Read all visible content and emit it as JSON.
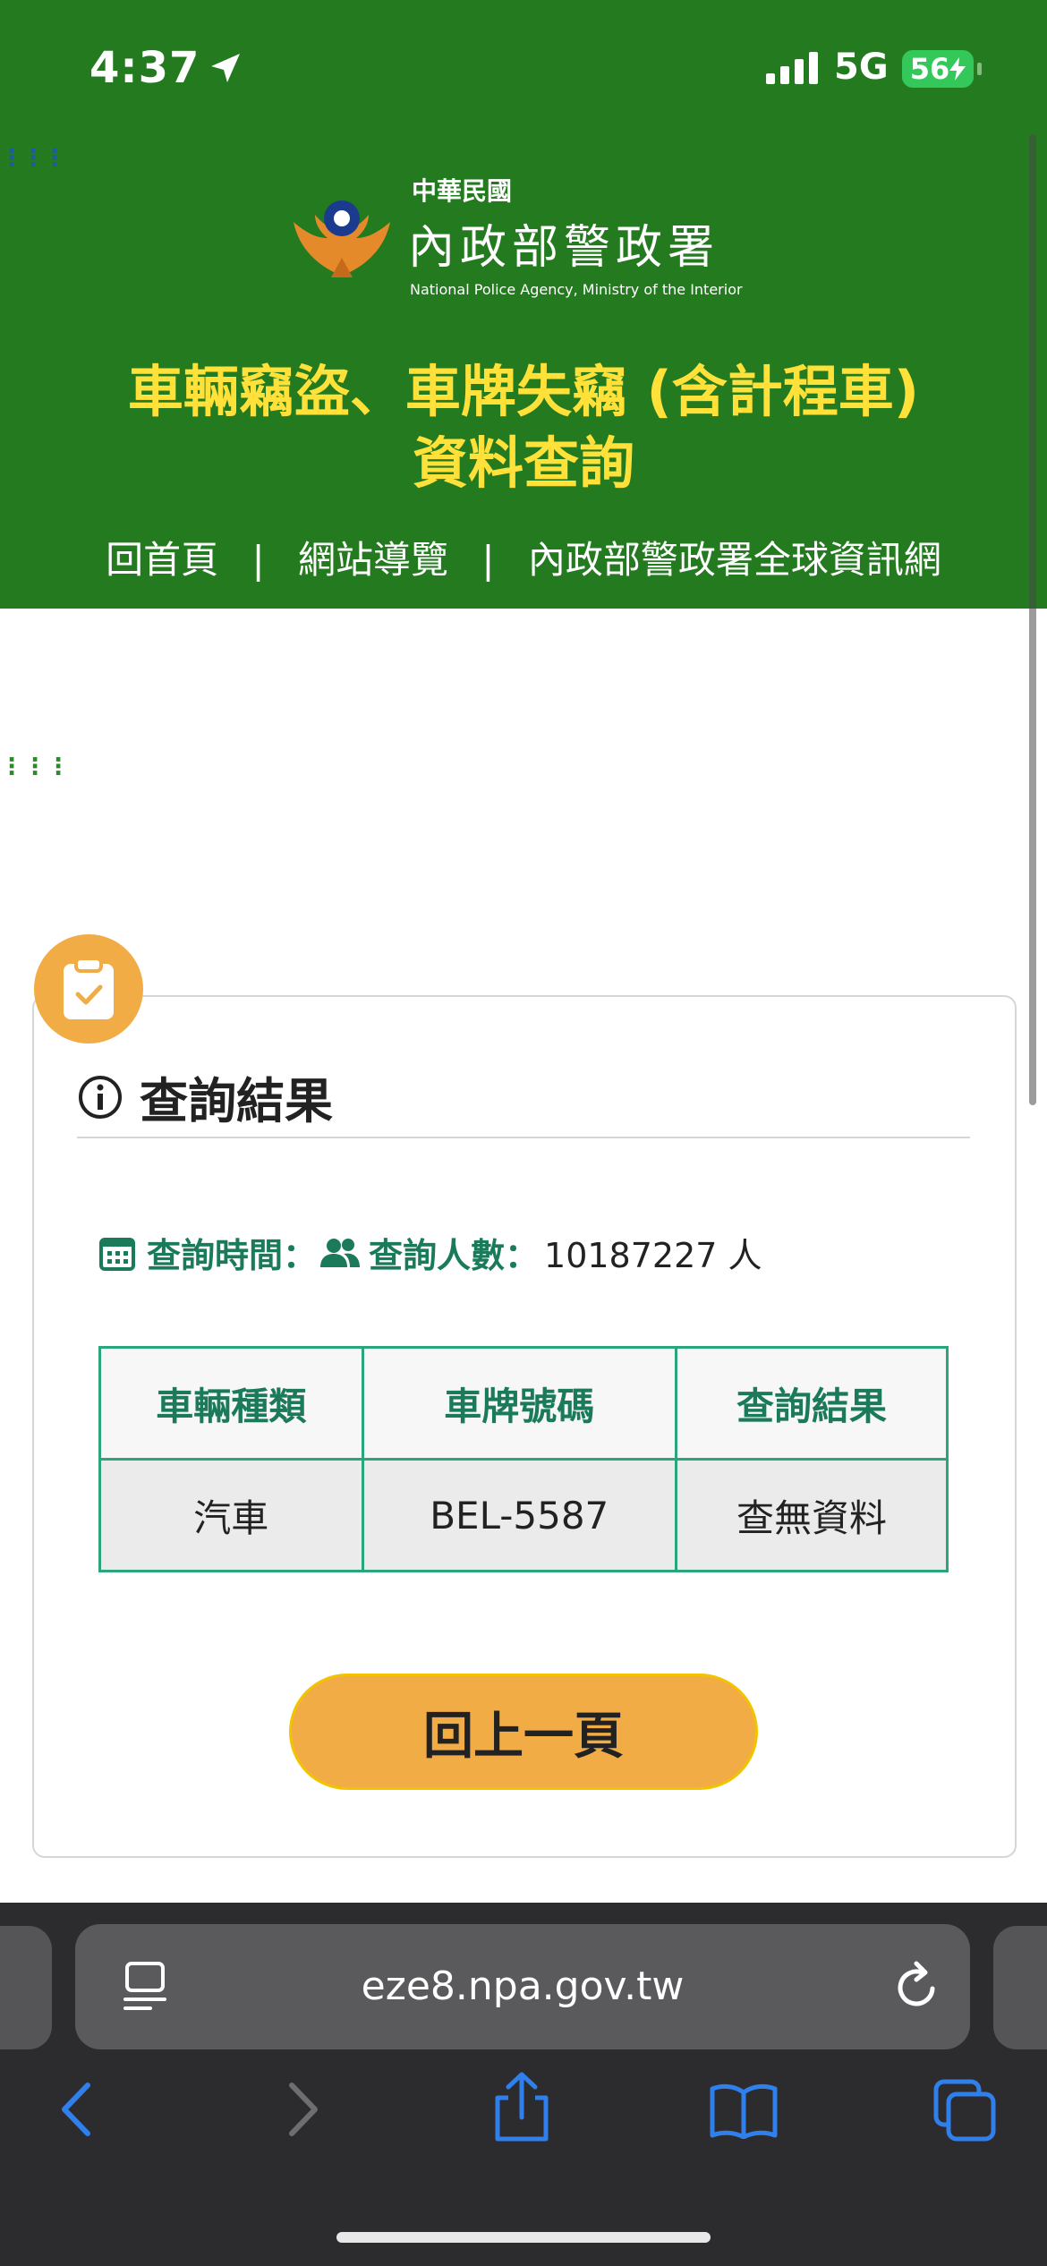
{
  "status_bar": {
    "time": "4:37",
    "network": "5G",
    "battery": "56"
  },
  "header": {
    "logo_roc": "中華民國",
    "logo_agency_cn": "內政部警政署",
    "logo_agency_en": "National Police Agency, Ministry of the Interior",
    "title_line1": "車輛竊盜、車牌失竊 (含計程車)",
    "title_line2": "資料查詢",
    "nav": [
      "回首頁",
      "網站導覽",
      "內政部警政署全球資訊網"
    ],
    "nav_separator": "|"
  },
  "result_section": {
    "title": "查詢結果",
    "query_time_label": "查詢時間：",
    "query_count_label": "查詢人數：",
    "query_count_value": "10187227 人",
    "table": {
      "headers": [
        "車輛種類",
        "車牌號碼",
        "查詢結果"
      ],
      "rows": [
        [
          "汽車",
          "BEL-5587",
          "查無資料"
        ]
      ]
    },
    "back_button": "回上一頁"
  },
  "browser": {
    "url": "eze8.npa.gov.tw"
  },
  "colors": {
    "header_green": "#237a1f",
    "title_yellow": "#ffe13a",
    "accent_orange": "#f1ac46",
    "table_border": "#2ba67a",
    "label_green": "#1a7a5a"
  }
}
